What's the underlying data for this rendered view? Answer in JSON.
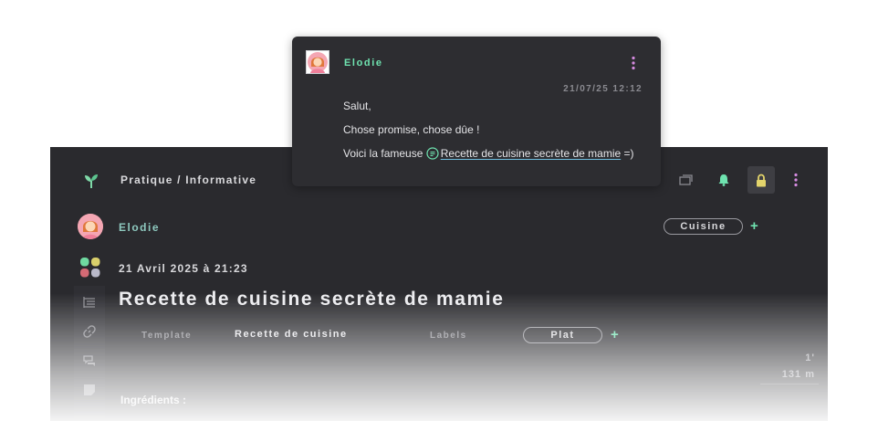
{
  "topbar": {
    "breadcrumb": "Pratique / Informative",
    "actions": [
      "windows-icon",
      "bell-icon",
      "lock-icon",
      "more-vertical-icon"
    ]
  },
  "document": {
    "author": "Elodie",
    "tag": "Cuisine",
    "tag_add": "+",
    "date": "21 Avril 2025 à 21:23",
    "title": "Recette de cuisine secrète de mamie",
    "template_label": "Template",
    "template_value": "Recette de cuisine",
    "labels_label": "Labels",
    "label_value": "Plat",
    "label_add": "+",
    "stat_1": "1'",
    "stat_2": "131 m",
    "section_heading": "Ingrédients :"
  },
  "side_rail": [
    "outline-icon",
    "link-icon",
    "chat-icon",
    "note-icon"
  ],
  "comment": {
    "author": "Elodie",
    "timestamp": "21/07/25 12:12",
    "line1": "Salut,",
    "line2": "Chose promise, chose dûe !",
    "line3_prefix": "Voici la fameuse",
    "link_text": "Recette de cuisine secrète de mamie",
    "line3_suffix": "=)"
  },
  "colors": {
    "accent_green": "#6fe3b0",
    "author_teal": "#8ec9bf",
    "menu_pink": "#d58be0",
    "lock_yellow": "#e3d46b",
    "window_bg": "#2a2a2e"
  }
}
